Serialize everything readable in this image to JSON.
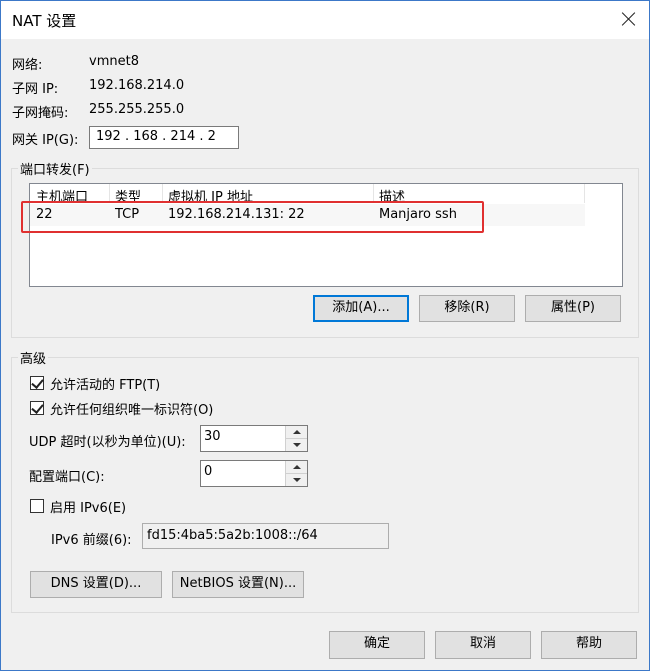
{
  "window": {
    "title": "NAT 设置"
  },
  "info": {
    "network_label": "网络:",
    "network_value": "vmnet8",
    "subnet_ip_label": "子网 IP:",
    "subnet_ip_value": "192.168.214.0",
    "subnet_mask_label": "子网掩码:",
    "subnet_mask_value": "255.255.255.0",
    "gateway_label": "网关 IP(G):",
    "gateway_value": "192 . 168 . 214 .  2"
  },
  "port_forwarding": {
    "group_label": "端口转发(F)",
    "columns": [
      "主机端口",
      "类型",
      "虚拟机 IP 地址",
      "描述"
    ],
    "rows": [
      {
        "host_port": "22",
        "type": "TCP",
        "vm_ip": "192.168.214.131: 22",
        "description": "Manjaro ssh"
      }
    ],
    "add_label": "添加(A)...",
    "remove_label": "移除(R)",
    "properties_label": "属性(P)"
  },
  "advanced": {
    "group_label": "高级",
    "allow_ftp_label": "允许活动的 FTP(T)",
    "allow_ftp_checked": true,
    "allow_oui_label": "允许任何组织唯一标识符(O)",
    "allow_oui_checked": true,
    "udp_timeout_label": "UDP 超时(以秒为单位)(U):",
    "udp_timeout_value": "30",
    "config_port_label": "配置端口(C):",
    "config_port_value": "0",
    "enable_ipv6_label": "启用 IPv6(E)",
    "enable_ipv6_checked": false,
    "ipv6_prefix_label": "IPv6 前缀(6):",
    "ipv6_prefix_value": "fd15:4ba5:5a2b:1008::/64",
    "dns_label": "DNS 设置(D)...",
    "netbios_label": "NetBIOS 设置(N)..."
  },
  "footer": {
    "ok_label": "确定",
    "cancel_label": "取消",
    "help_label": "帮助"
  },
  "colors": {
    "accent": "#0078d7",
    "highlight": "#e03030"
  }
}
